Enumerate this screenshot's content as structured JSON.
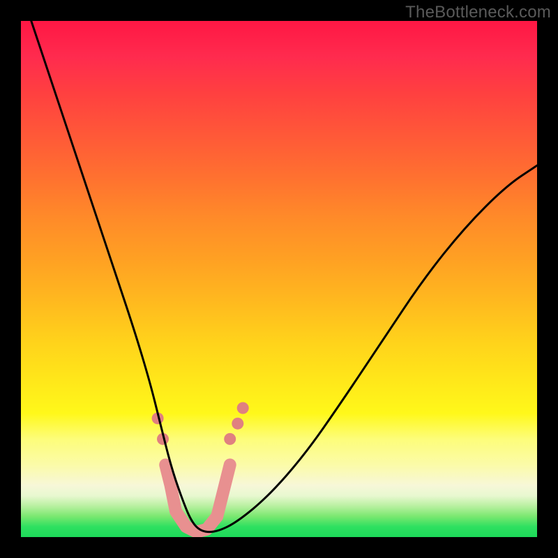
{
  "watermark": "TheBottleneck.com",
  "chart_data": {
    "type": "line",
    "title": "",
    "xlabel": "",
    "ylabel": "",
    "xlim": [
      0,
      100
    ],
    "ylim": [
      0,
      100
    ],
    "grid": false,
    "legend": false,
    "background_gradient": {
      "direction": "vertical",
      "stops": [
        {
          "pos": 0,
          "color": "#ff1744",
          "meaning": "high bottleneck"
        },
        {
          "pos": 50,
          "color": "#ffa023",
          "meaning": "moderate"
        },
        {
          "pos": 80,
          "color": "#fff81a",
          "meaning": "mild"
        },
        {
          "pos": 100,
          "color": "#1ddb5a",
          "meaning": "no bottleneck"
        }
      ]
    },
    "series": [
      {
        "name": "bottleneck-curve",
        "x": [
          2,
          6,
          10,
          14,
          18,
          22,
          25,
          27,
          29,
          31,
          33,
          35,
          38,
          42,
          48,
          55,
          62,
          70,
          78,
          86,
          94,
          100
        ],
        "y": [
          100,
          88,
          76,
          64,
          52,
          40,
          30,
          22,
          14,
          8,
          3,
          1,
          1,
          3,
          8,
          16,
          26,
          38,
          50,
          60,
          68,
          72
        ]
      }
    ],
    "annotations": [
      {
        "name": "highlight-dots",
        "type": "scatter",
        "color": "#e08080",
        "points": [
          {
            "x": 26.5,
            "y": 23
          },
          {
            "x": 27.5,
            "y": 19
          },
          {
            "x": 40.5,
            "y": 19
          },
          {
            "x": 42.0,
            "y": 22
          },
          {
            "x": 43.0,
            "y": 25
          }
        ]
      },
      {
        "name": "bottom-highlight-segment",
        "type": "thick-line",
        "color": "#e89090",
        "points": [
          {
            "x": 28,
            "y": 14
          },
          {
            "x": 29,
            "y": 10
          },
          {
            "x": 30,
            "y": 5
          },
          {
            "x": 32,
            "y": 2
          },
          {
            "x": 34,
            "y": 1
          },
          {
            "x": 36,
            "y": 1.5
          },
          {
            "x": 38,
            "y": 4
          },
          {
            "x": 39.5,
            "y": 10
          },
          {
            "x": 40.5,
            "y": 14
          }
        ]
      }
    ]
  }
}
